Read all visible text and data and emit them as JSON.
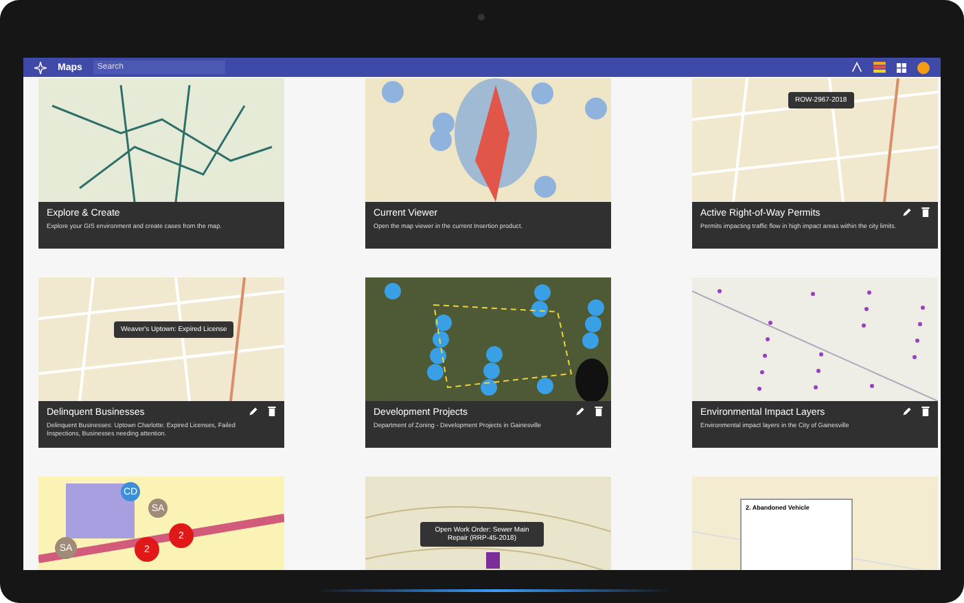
{
  "app_bar": {
    "title": "Maps",
    "search": {
      "placeholder": "Search"
    }
  },
  "cards": [
    {
      "title": "Explore & Create",
      "description": "Explore your GIS environment and create cases from the map.",
      "editable": false,
      "kind": "network"
    },
    {
      "title": "Current Viewer",
      "description": "Open the map viewer in the current Insertion product.",
      "editable": false,
      "kind": "heat"
    },
    {
      "title": "Active Right-of-Way Permits",
      "description": "Permits impacting traffic flow in high impact areas within the city limits.",
      "editable": true,
      "kind": "streets",
      "tooltip": "ROW-2967-2018"
    },
    {
      "title": "Delinquent Businesses",
      "description": "Delinquent Businesses: Uptown Charlotte: Expired Licenses, Failed Inspections, Businesses needing attention.",
      "editable": true,
      "kind": "streets",
      "tooltip": "Weaver's Uptown: Expired License"
    },
    {
      "title": "Development Projects",
      "description": "Department of Zoning - Development Projects in Gainesville",
      "editable": true,
      "kind": "satellite"
    },
    {
      "title": "Environmental Impact Layers",
      "description": "Environmental impact layers in the City of Gainesville",
      "editable": true,
      "kind": "points"
    },
    {
      "kind": "parcels",
      "markers": [
        "CD",
        "SA",
        "SA",
        "2",
        "2"
      ]
    },
    {
      "kind": "topo",
      "tooltip": "Open Work Order: Sewer Main Repair (RRP-45-2018)"
    },
    {
      "kind": "plain",
      "popup": "2. Abandoned Vehicle"
    }
  ]
}
